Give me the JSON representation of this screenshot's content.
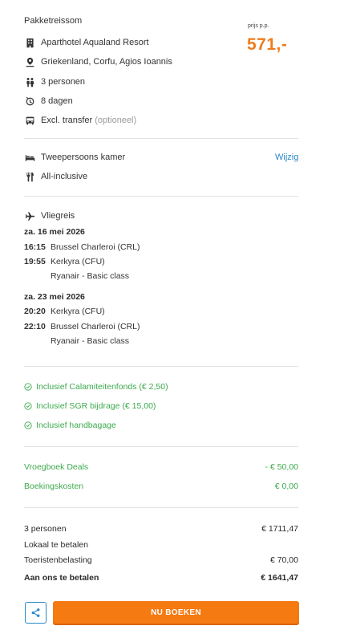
{
  "summary": {
    "title": "Pakketreissom",
    "price_label": "prijs p.p.",
    "price": "571,-",
    "hotel": "Aparthotel Aqualand Resort",
    "location": "Griekenland, Corfu, Agios Ioannis",
    "persons": "3 personen",
    "duration": "8 dagen",
    "transfer": "Excl. transfer",
    "transfer_note": "(optioneel)"
  },
  "room": {
    "type": "Tweepersoons kamer",
    "board": "All-inclusive",
    "edit_label": "Wijzig"
  },
  "flight": {
    "header": "Vliegreis",
    "outbound": {
      "date": "za. 16 mei 2026",
      "legs": [
        {
          "time": "16:15",
          "place": "Brussel Charleroi (CRL)"
        },
        {
          "time": "19:55",
          "place": "Kerkyra (CFU)"
        }
      ],
      "airline": "Ryanair - Basic class"
    },
    "return": {
      "date": "za. 23 mei 2026",
      "legs": [
        {
          "time": "20:20",
          "place": "Kerkyra (CFU)"
        },
        {
          "time": "22:10",
          "place": "Brussel Charleroi (CRL)"
        }
      ],
      "airline": "Ryanair - Basic class"
    }
  },
  "included": [
    "Inclusief Calamiteitenfonds (€ 2,50)",
    "Inclusief SGR bijdrage (€ 15,00)",
    "Inclusief handbagage"
  ],
  "discounts": [
    {
      "label": "Vroegboek Deals",
      "value": "- € 50,00"
    },
    {
      "label": "Boekingskosten",
      "value": "€ 0,00"
    }
  ],
  "totals": {
    "persons_label": "3 personen",
    "persons_value": "€ 1711,47",
    "local_label": "Lokaal te betalen",
    "tax_label": "Toeristenbelasting",
    "tax_value": "€ 70,00",
    "pay_label": "Aan ons te betalen",
    "pay_value": "€ 1641,47"
  },
  "actions": {
    "book_label": "NU BOEKEN"
  },
  "colors": {
    "accent_orange": "#f57a12",
    "link_blue": "#2a88c6",
    "green": "#3daa4e"
  }
}
